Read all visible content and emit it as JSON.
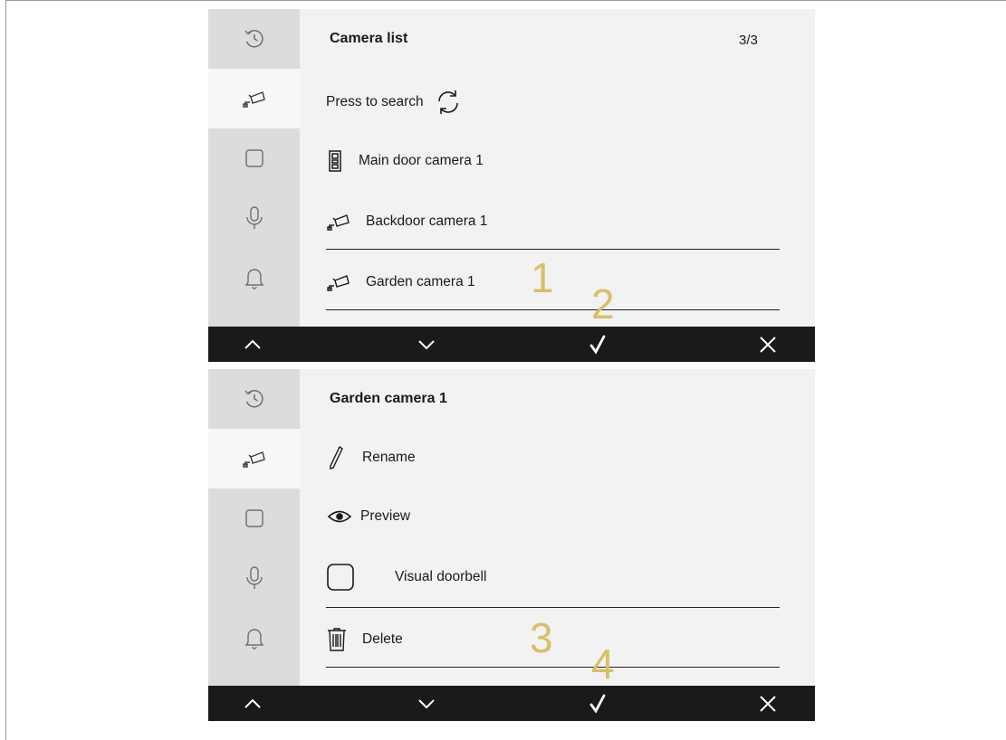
{
  "screens": [
    {
      "title": "Camera list",
      "page_indicator": "3/3",
      "search": {
        "label": "Press to search",
        "icon": "refresh-icon"
      },
      "items": [
        {
          "label": "Main door camera 1",
          "icon": "door-station-icon"
        },
        {
          "label": "Backdoor camera 1",
          "icon": "camera-icon"
        },
        {
          "label": "Garden camera 1",
          "icon": "camera-icon"
        }
      ],
      "annotations": [
        "1",
        "2"
      ]
    },
    {
      "title": "Garden camera 1",
      "options": [
        {
          "label": "Rename",
          "icon": "pencil-icon"
        },
        {
          "label": "Preview",
          "icon": "eye-icon"
        },
        {
          "label": "Visual doorbell",
          "icon": "checkbox-icon"
        },
        {
          "label": "Delete",
          "icon": "trash-icon"
        }
      ],
      "annotations": [
        "3",
        "4"
      ]
    }
  ],
  "sidebar": [
    "history-icon",
    "camera-icon",
    "square-icon",
    "microphone-icon",
    "bell-icon"
  ],
  "bottom_bar": [
    "chevron-up-icon",
    "chevron-down-icon",
    "check-icon",
    "close-icon"
  ],
  "colors": {
    "screen_bg": "#f2f2f2",
    "sidebar_bg": "#dcdcdc",
    "active_item_bg": "#f7f7f7",
    "bar_bg": "#1a1a1a",
    "annotation": "#d9be6a"
  }
}
